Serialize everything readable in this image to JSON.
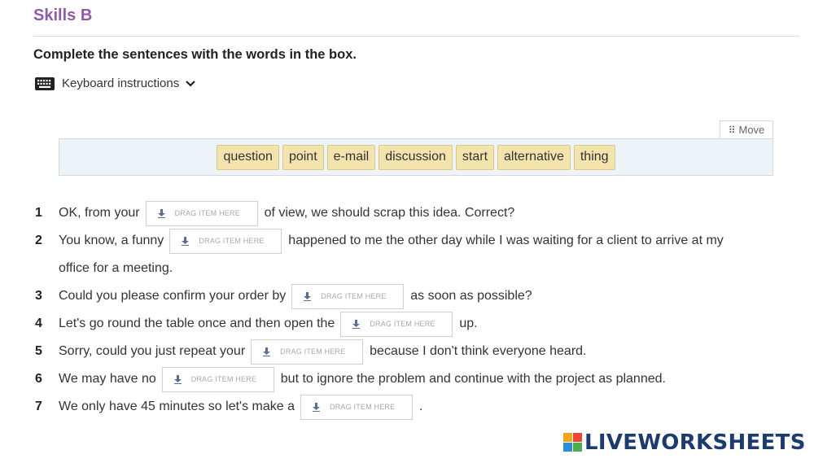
{
  "title": "Skills B",
  "instructions": "Complete the sentences with the words in the box.",
  "keyboard_label": "Keyboard instructions",
  "move_label": "Move",
  "words": [
    "question",
    "point",
    "e-mail",
    "discussion",
    "start",
    "alternative",
    "thing"
  ],
  "drop_label": "DRAG ITEM HERE",
  "questions": [
    {
      "num": "1",
      "before": "OK, from your",
      "after": "of view, we should scrap this idea. Correct?"
    },
    {
      "num": "2",
      "before": "You know, a funny",
      "after": "happened to me the other day while I was waiting for a client to arrive at my",
      "continuation": "office for a meeting."
    },
    {
      "num": "3",
      "before": "Could you please confirm your order by",
      "after": "as soon as possible?"
    },
    {
      "num": "4",
      "before": "Let's go round the table once and then open the",
      "after": "up."
    },
    {
      "num": "5",
      "before": "Sorry, could you just repeat your",
      "after": "because I don't think everyone heard."
    },
    {
      "num": "6",
      "before": "We may have no",
      "after": "but to ignore the problem and continue with the project as planned."
    },
    {
      "num": "7",
      "before": "We only have 45 minutes so let's make a",
      "after": "."
    }
  ],
  "logo_text": "LIVEWORKSHEETS",
  "colors": {
    "title": "#8e5ba8",
    "chip": "#f3e4ae",
    "word_box": "#eef3f8",
    "logo": "#1c3b6f"
  }
}
